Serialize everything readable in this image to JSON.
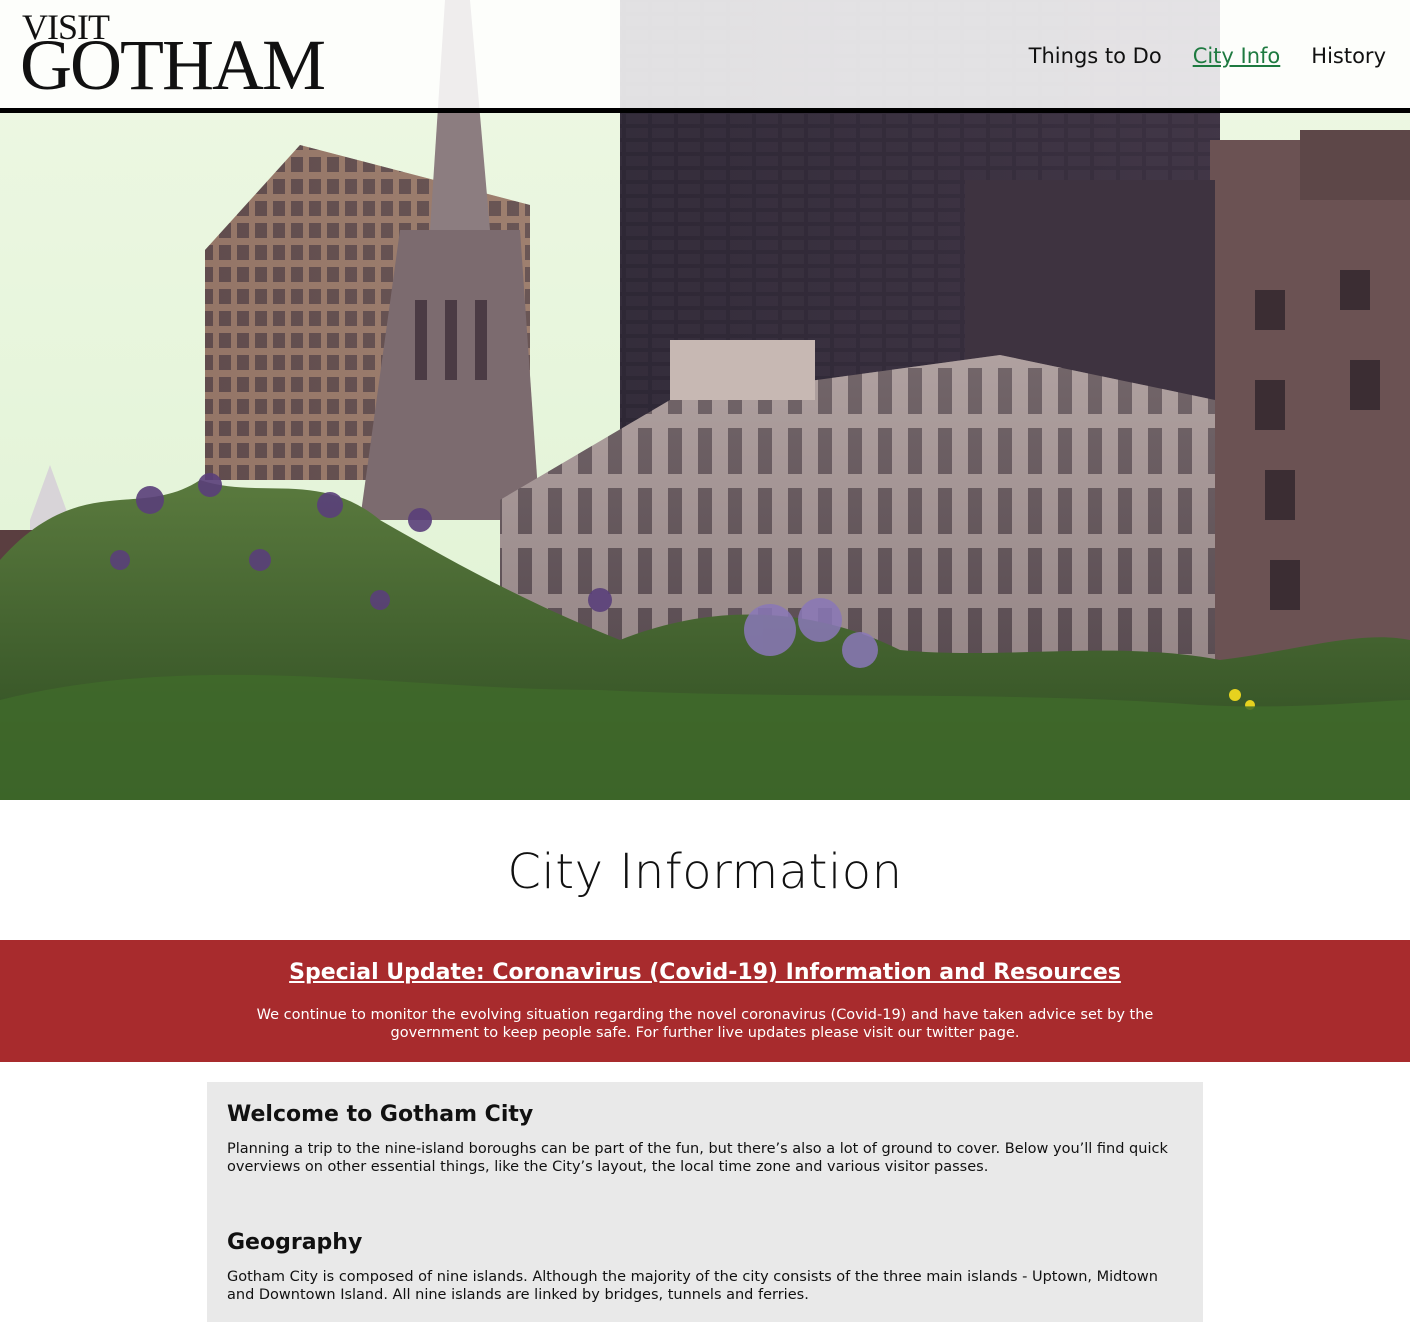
{
  "logo": {
    "line1": "VISIT",
    "line2": "GOTHAM"
  },
  "nav": {
    "items": [
      {
        "label": "Things to Do"
      },
      {
        "label": "City Info"
      },
      {
        "label": "History"
      }
    ],
    "active_color": "#1e7a40"
  },
  "page_title": "City Information",
  "alert": {
    "title": "Special Update: Coronavirus (Covid-19) Information and Resources",
    "text": "We continue to monitor the evolving situation regarding the novel coronavirus (Covid-19) and have taken advice set by the government to keep people safe. For further live updates please visit our twitter page.",
    "background": "#a82b2d"
  },
  "sections": [
    {
      "heading": "Welcome to Gotham City",
      "text": "Planning a trip to the nine-island boroughs can be part of the fun, but there’s also a lot of ground to cover. Below you’ll find quick overviews on other essential things, like the City’s layout, the local time zone and various visitor passes."
    },
    {
      "heading": "Geography",
      "text": "Gotham City is composed of nine islands. Although the majority of the city consists of the three main islands - Uptown, Midtown and Downtown Island. All nine islands are linked by bridges, tunnels and ferries."
    }
  ]
}
